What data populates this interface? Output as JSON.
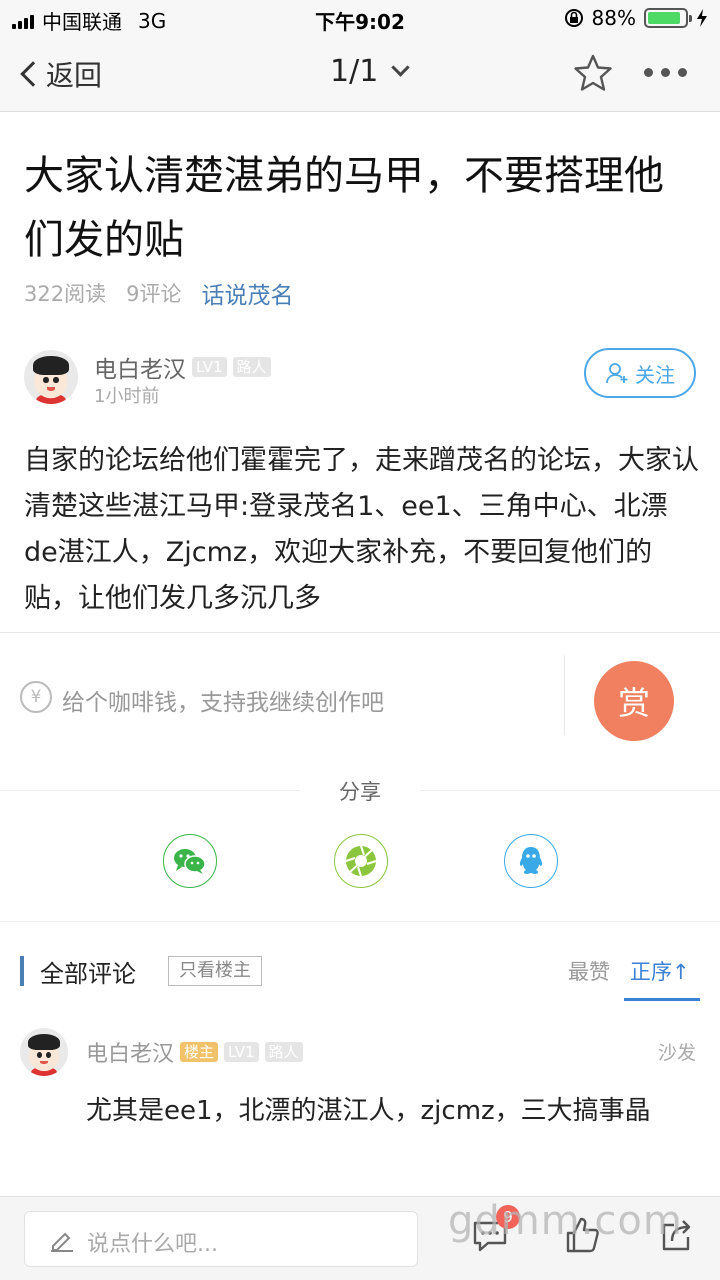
{
  "status": {
    "carrier": "中国联通",
    "network": "3G",
    "time": "下午9:02",
    "battery": "88%",
    "battery_level": 0.88
  },
  "nav": {
    "back_label": "返回",
    "page_indicator": "1/1"
  },
  "post": {
    "title": "大家认清楚湛弟的马甲，不要搭理他们发的贴",
    "reads": "322阅读",
    "comments_count": "9评论",
    "topic": "话说茂名",
    "author": {
      "name": "电白老汉",
      "level": "LV1",
      "role": "路人",
      "time_ago": "1小时前"
    },
    "follow_label": "关注",
    "body": "自家的论坛给他们霍霍完了，走来蹭茂名的论坛，大家认清楚这些湛江马甲:登录茂名1、ee1、三角中心、北漂de湛江人，Zjcmz，欢迎大家补充，不要回复他们的贴，让他们发几多沉几多"
  },
  "tip": {
    "currency_symbol": "¥",
    "text": "给个咖啡钱，支持我继续创作吧",
    "reward_label": "赏"
  },
  "share": {
    "label": "分享",
    "icons": [
      {
        "name": "wechat-icon",
        "color": "#3bb54a"
      },
      {
        "name": "moments-icon",
        "color": "#8cc63f"
      },
      {
        "name": "qq-icon",
        "color": "#3aa9e8"
      }
    ]
  },
  "comments_section": {
    "title": "全部评论",
    "only_host_label": "只看楼主",
    "sort_best": "最赞",
    "sort_order": "正序↑",
    "items": [
      {
        "author": "电白老汉",
        "host_badge": "楼主",
        "level": "LV1",
        "role": "路人",
        "floor": "沙发",
        "text": "尤其是ee1，北漂的湛江人，zjcmz，三大搞事晶"
      }
    ]
  },
  "bottom": {
    "input_placeholder": "说点什么吧...",
    "comment_badge": "9",
    "watermark": "gdmm.com"
  },
  "colors": {
    "accent_blue": "#3b82d4",
    "topic_blue": "#4a7fb5",
    "reward_orange": "#f0805f"
  }
}
